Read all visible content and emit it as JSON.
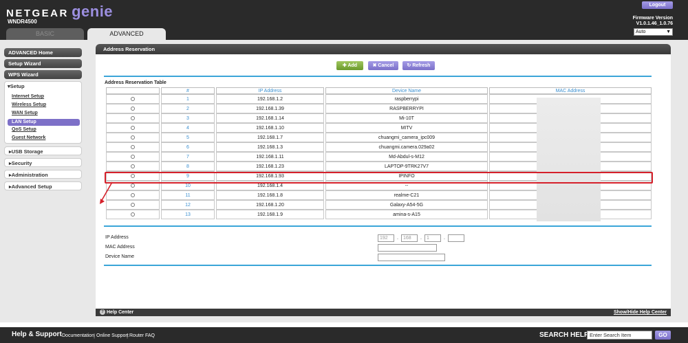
{
  "header": {
    "brand": "NETGEAR",
    "product": "genie",
    "model": "WNDR4500",
    "tabs": {
      "basic": "BASIC",
      "advanced": "ADVANCED"
    },
    "logout": "Logout",
    "firmware_label": "Firmware Version",
    "firmware_version": "V1.0.1.46_1.0.76",
    "language": "Auto"
  },
  "nav": {
    "advanced_home": "ADVANCED Home",
    "setup_wizard": "Setup Wizard",
    "wps_wizard": "WPS Wizard",
    "setup": "▾Setup",
    "setup_items": [
      "Internet Setup",
      "Wireless Setup",
      "WAN Setup",
      "LAN Setup",
      "QoS Setup",
      "Guest Network"
    ],
    "usb_storage": "▸USB Storage",
    "security": "▸Security",
    "administration": "▸Administration",
    "advanced_setup": "▸Advanced Setup"
  },
  "page": {
    "title": "Address Reservation",
    "buttons": {
      "add": "✚ Add",
      "cancel": "✖ Cancel",
      "refresh": "↻ Refresh"
    },
    "table_title": "Address Reservation Table",
    "columns": [
      "#",
      "IP Address",
      "Device Name",
      "MAC Address"
    ],
    "rows": [
      {
        "num": "1",
        "ip": "192.168.1.2",
        "name": "raspberrypi"
      },
      {
        "num": "2",
        "ip": "192.168.1.39",
        "name": "RASPBERRYPI"
      },
      {
        "num": "3",
        "ip": "192.168.1.14",
        "name": "Mi-10T"
      },
      {
        "num": "4",
        "ip": "192.168.1.10",
        "name": "MITV"
      },
      {
        "num": "5",
        "ip": "192.168.1.7",
        "name": "chuangmi_camera_ipc009"
      },
      {
        "num": "6",
        "ip": "192.168.1.3",
        "name": "chuangmi.camera.029a02"
      },
      {
        "num": "7",
        "ip": "192.168.1.11",
        "name": "Md-Abdul-s-M12"
      },
      {
        "num": "8",
        "ip": "192.168.1.23",
        "name": "LAPTOP-9TRK27V7"
      },
      {
        "num": "9",
        "ip": "192.168.1.93",
        "name": "IPINFO"
      },
      {
        "num": "10",
        "ip": "192.168.1.4",
        "name": "--"
      },
      {
        "num": "11",
        "ip": "192.168.1.8",
        "name": "realme-C21"
      },
      {
        "num": "12",
        "ip": "192.168.1.20",
        "name": "Galaxy-A54-5G"
      },
      {
        "num": "13",
        "ip": "192.168.1.9",
        "name": "amina-s-A15"
      }
    ],
    "form": {
      "ip_label": "IP Address",
      "ip_parts": [
        "192",
        "168",
        "1",
        ""
      ],
      "mac_label": "MAC Address",
      "device_label": "Device Name"
    },
    "help_center": "Help Center",
    "show_hide": "Show/Hide Help Center"
  },
  "footer": {
    "title": "Help & Support",
    "links": [
      "Documentation",
      "Online Support",
      "Router FAQ"
    ],
    "search_label": "SEARCH HELP",
    "search_placeholder": "Enter Search Item",
    "go": "GO"
  },
  "colors": {
    "accent": "#7b70c9",
    "highlight": "#d5202a",
    "rule": "#3aa5d8",
    "add": "#6b9a2c"
  }
}
